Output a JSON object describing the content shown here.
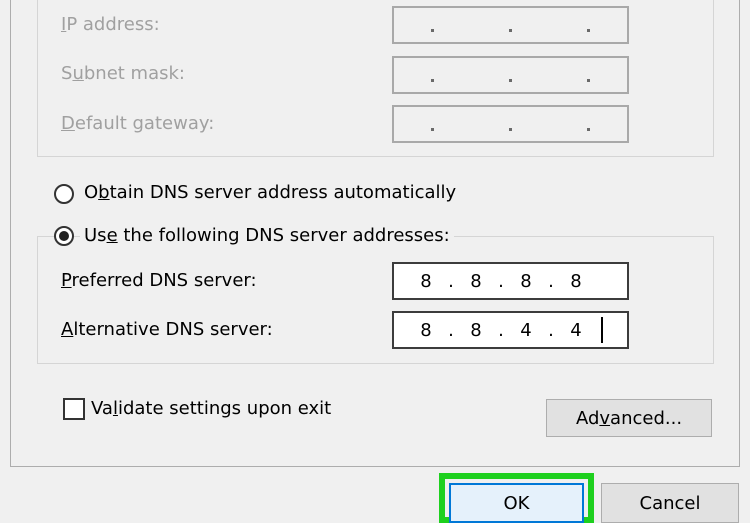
{
  "ip_group": {
    "ip_address_label_prefix": "I",
    "ip_address_label_rest": "P address:",
    "subnet_label_prefix": "S",
    "subnet_label_u": "u",
    "subnet_label_rest": "bnet mask:",
    "gateway_label_prefix": "",
    "gateway_label_u": "D",
    "gateway_label_rest": "efault gateway:"
  },
  "dns": {
    "auto_label_pre": "O",
    "auto_label_u": "b",
    "auto_label_rest": "tain DNS server address automatically",
    "auto_selected": false,
    "manual_label_pre": "Us",
    "manual_label_u": "e",
    "manual_label_rest": " the following DNS server addresses:",
    "manual_selected": true,
    "preferred_label_u": "P",
    "preferred_label_rest": "referred DNS server:",
    "preferred_octets": [
      "8",
      "8",
      "8",
      "8"
    ],
    "alternative_label_u": "A",
    "alternative_label_rest": "lternative DNS server:",
    "alternative_octets": [
      "8",
      "8",
      "4",
      "4"
    ]
  },
  "validate": {
    "label_pre": "Va",
    "label_u": "l",
    "label_rest": "idate settings upon exit",
    "checked": false
  },
  "buttons": {
    "advanced_pre": "Ad",
    "advanced_u": "v",
    "advanced_rest": "anced...",
    "ok": "OK",
    "cancel": "Cancel"
  },
  "colors": {
    "highlight_green": "#1ed01e",
    "focus_blue": "#0078d7"
  }
}
